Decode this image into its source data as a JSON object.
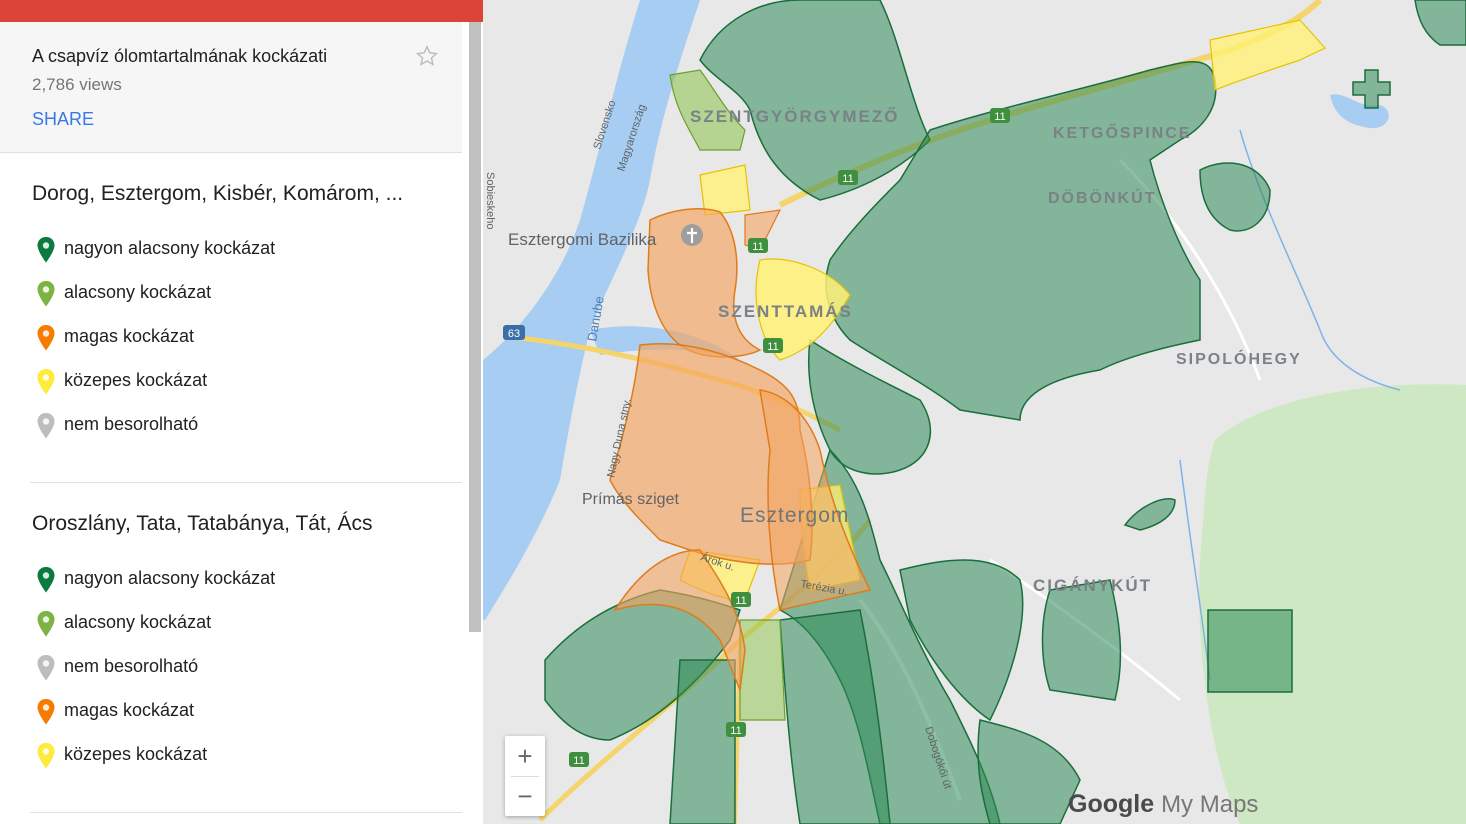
{
  "sidebar": {
    "map_title": "A csapvíz ólomtartalmának kockázati",
    "views": "2,786 views",
    "share_label": "SHARE",
    "layers": [
      {
        "title": "Dorog, Esztergom, Kisbér, Komárom, ...",
        "items": [
          {
            "label": "nagyon alacsony kockázat",
            "color": "#0b7a3e"
          },
          {
            "label": "alacsony kockázat",
            "color": "#7cb342"
          },
          {
            "label": "magas kockázat",
            "color": "#f57c00"
          },
          {
            "label": "közepes kockázat",
            "color": "#ffeb3b"
          },
          {
            "label": "nem besorolható",
            "color": "#bdbdbd"
          }
        ]
      },
      {
        "title": "Oroszlány, Tata, Tatabánya, Tát, Ács",
        "items": [
          {
            "label": "nagyon alacsony kockázat",
            "color": "#0b7a3e"
          },
          {
            "label": "alacsony kockázat",
            "color": "#7cb342"
          },
          {
            "label": "nem besorolható",
            "color": "#bdbdbd"
          },
          {
            "label": "magas kockázat",
            "color": "#f57c00"
          },
          {
            "label": "közepes kockázat",
            "color": "#ffeb3b"
          }
        ]
      }
    ]
  },
  "map": {
    "labels": {
      "szentgyorgymezo": "SZENTGYÖRGYMEZŐ",
      "ketgspince": "KETGŐSPINCE",
      "dobonkut": "DÖBÖNKÚT",
      "szenttamas": "SZENTTAMÁS",
      "sipolohegy": "SIPOLÓHEGY",
      "ciganykut": "CIGÁNYKÚT",
      "esztergom": "Esztergom",
      "bazilika": "Esztergomi Bazilika",
      "primas": "Prímás sziget",
      "danube": "Danube",
      "slovensko": "Slovensko",
      "magyarorszag": "Magyarország",
      "sobieskeho": "Sobieskeho",
      "nagyduna": "Nagy Duna stny.",
      "arok": "Árok u.",
      "terezia": "Terézia u.",
      "dobogokoi": "Dobogókői út"
    },
    "road_badges": [
      "63",
      "11",
      "11",
      "11",
      "11",
      "11",
      "11",
      "11"
    ],
    "zoom_in": "+",
    "zoom_out": "−",
    "logo_google": "Google",
    "logo_mymaps": "My Maps"
  }
}
